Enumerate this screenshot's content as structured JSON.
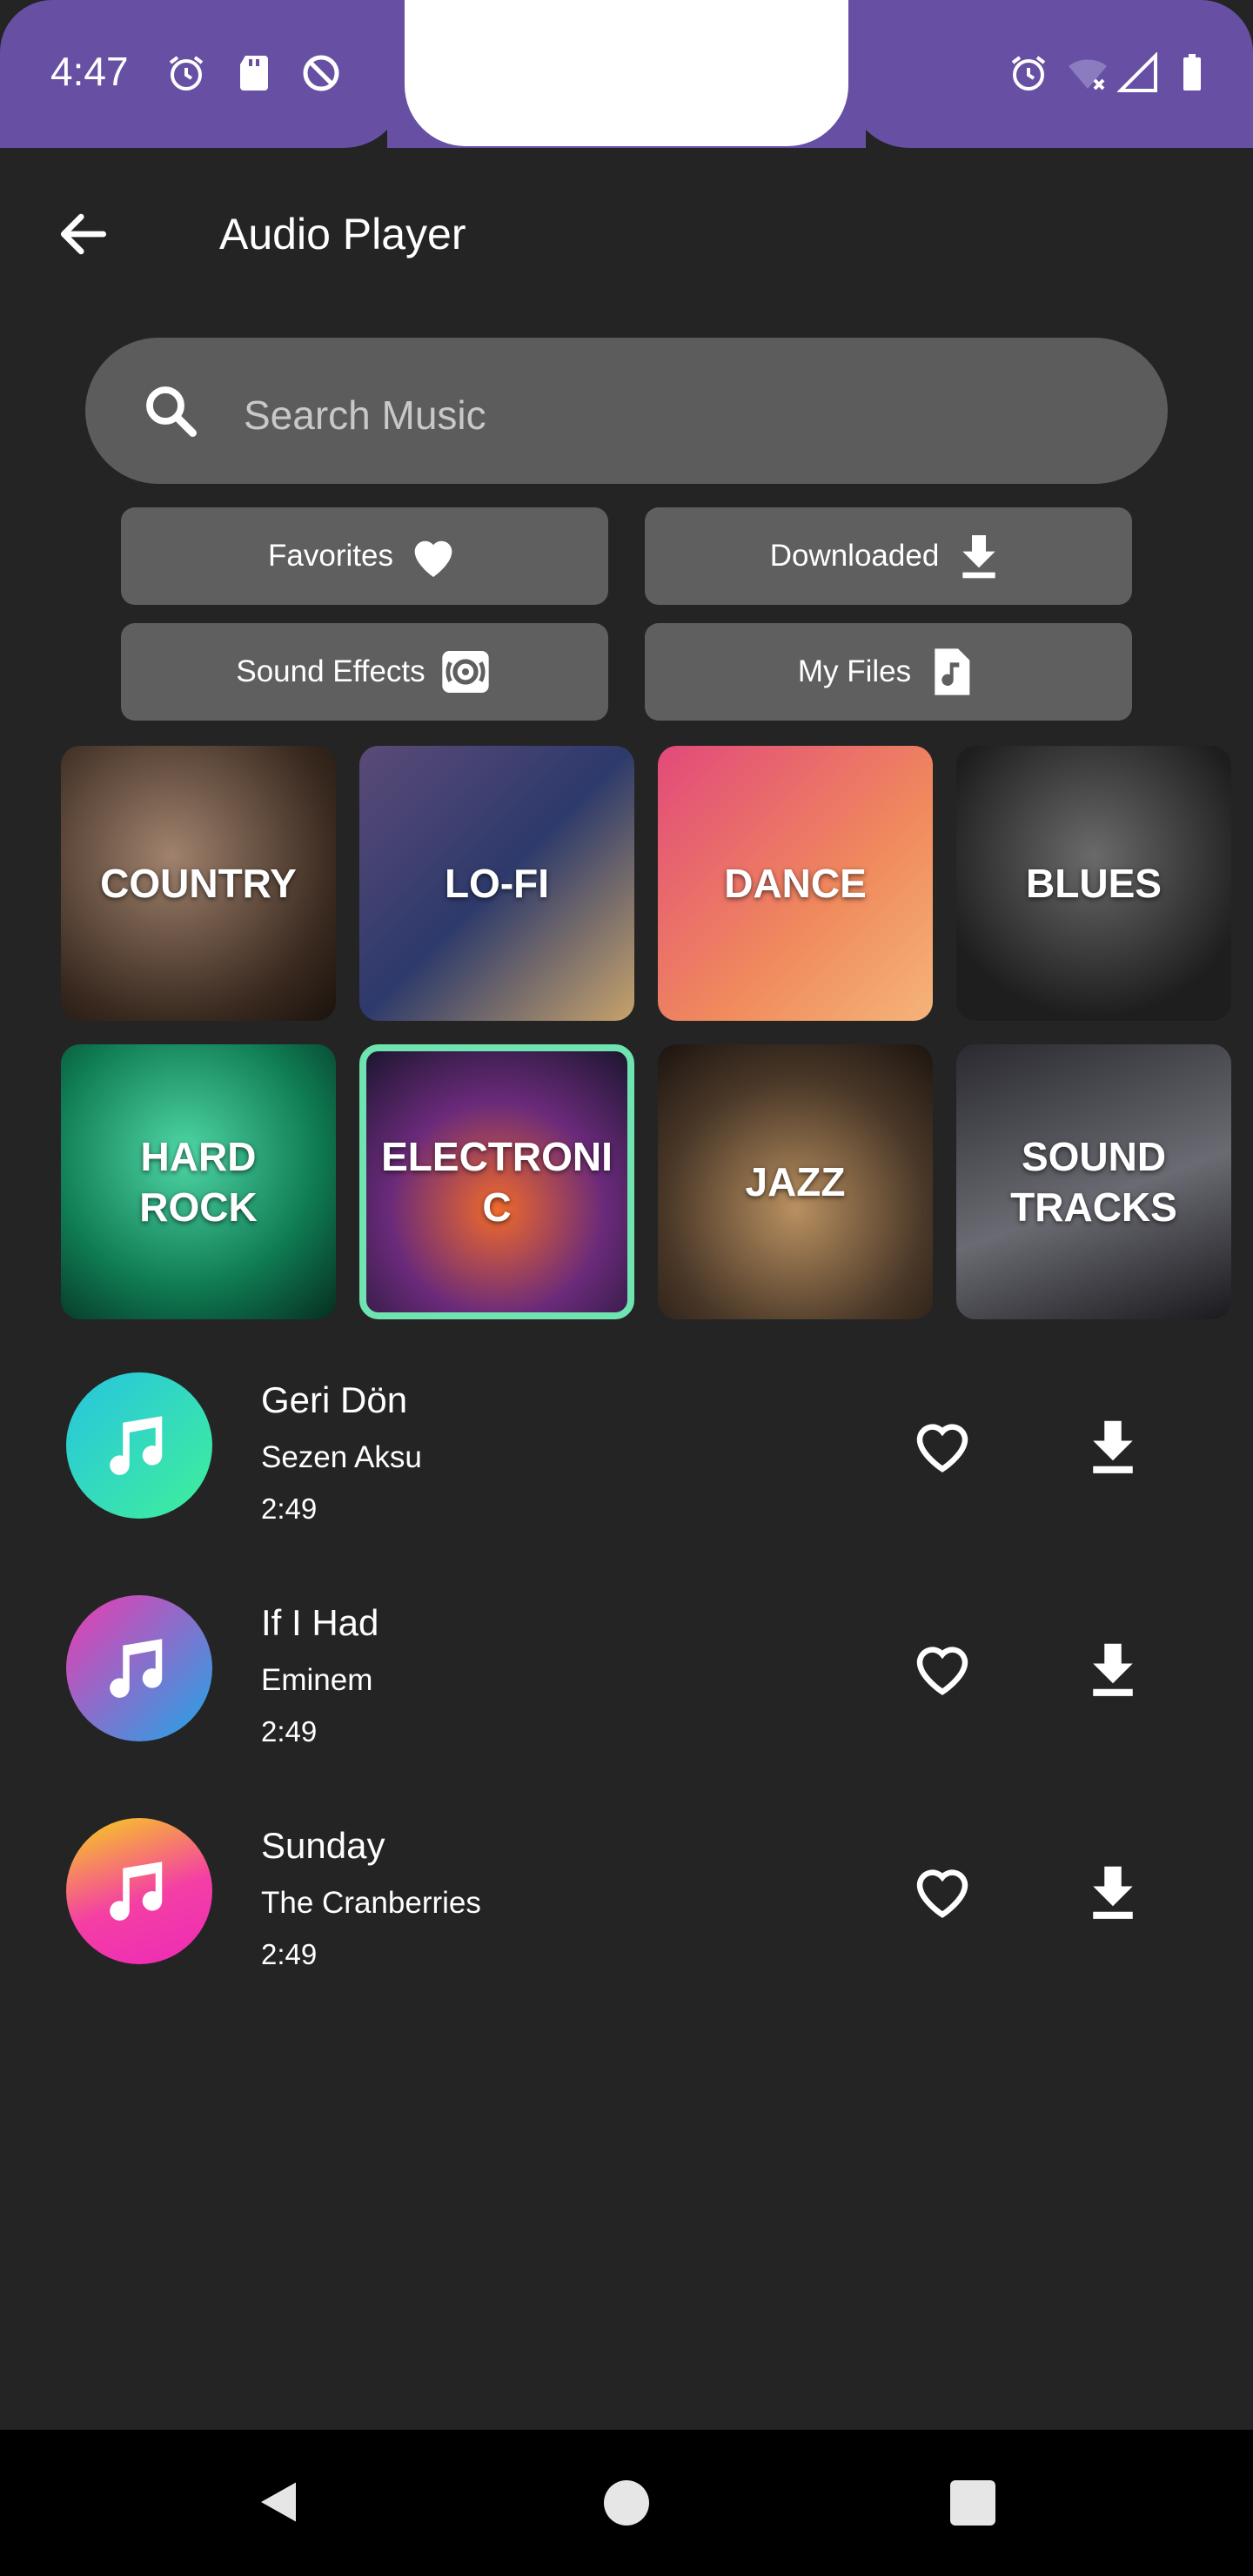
{
  "status_bar": {
    "time": "4:47",
    "color": "#6750a4"
  },
  "app_bar": {
    "title": "Audio Player",
    "back_icon": "arrow-left-icon"
  },
  "search": {
    "placeholder": "Search Music",
    "icon": "search-icon"
  },
  "quick_buttons": [
    {
      "label": "Favorites",
      "icon": "heart-icon"
    },
    {
      "label": "Downloaded",
      "icon": "download-icon"
    },
    {
      "label": "Sound Effects",
      "icon": "sound-effects-icon"
    },
    {
      "label": "My Files",
      "icon": "music-file-icon"
    }
  ],
  "genres": [
    {
      "label": "COUNTRY",
      "selected": false
    },
    {
      "label": "LO-FI",
      "selected": false
    },
    {
      "label": "DANCE",
      "selected": false
    },
    {
      "label": "BLUES",
      "selected": false
    },
    {
      "label": "HARD ROCK",
      "selected": false
    },
    {
      "label": "ELECTRONIC",
      "selected": true
    },
    {
      "label": "JAZZ",
      "selected": false
    },
    {
      "label": "SOUND TRACKS",
      "selected": false
    }
  ],
  "tracks": [
    {
      "title": "Geri Dön",
      "artist": "Sezen Aksu",
      "duration": "2:49"
    },
    {
      "title": "If I Had",
      "artist": "Eminem",
      "duration": "2:49"
    },
    {
      "title": "Sunday",
      "artist": "The Cranberries",
      "duration": "2:49"
    }
  ],
  "colors": {
    "background": "#242424",
    "button": "#5f5f5f",
    "selected_outline": "#6fe3b0",
    "accent": "#6750a4"
  }
}
